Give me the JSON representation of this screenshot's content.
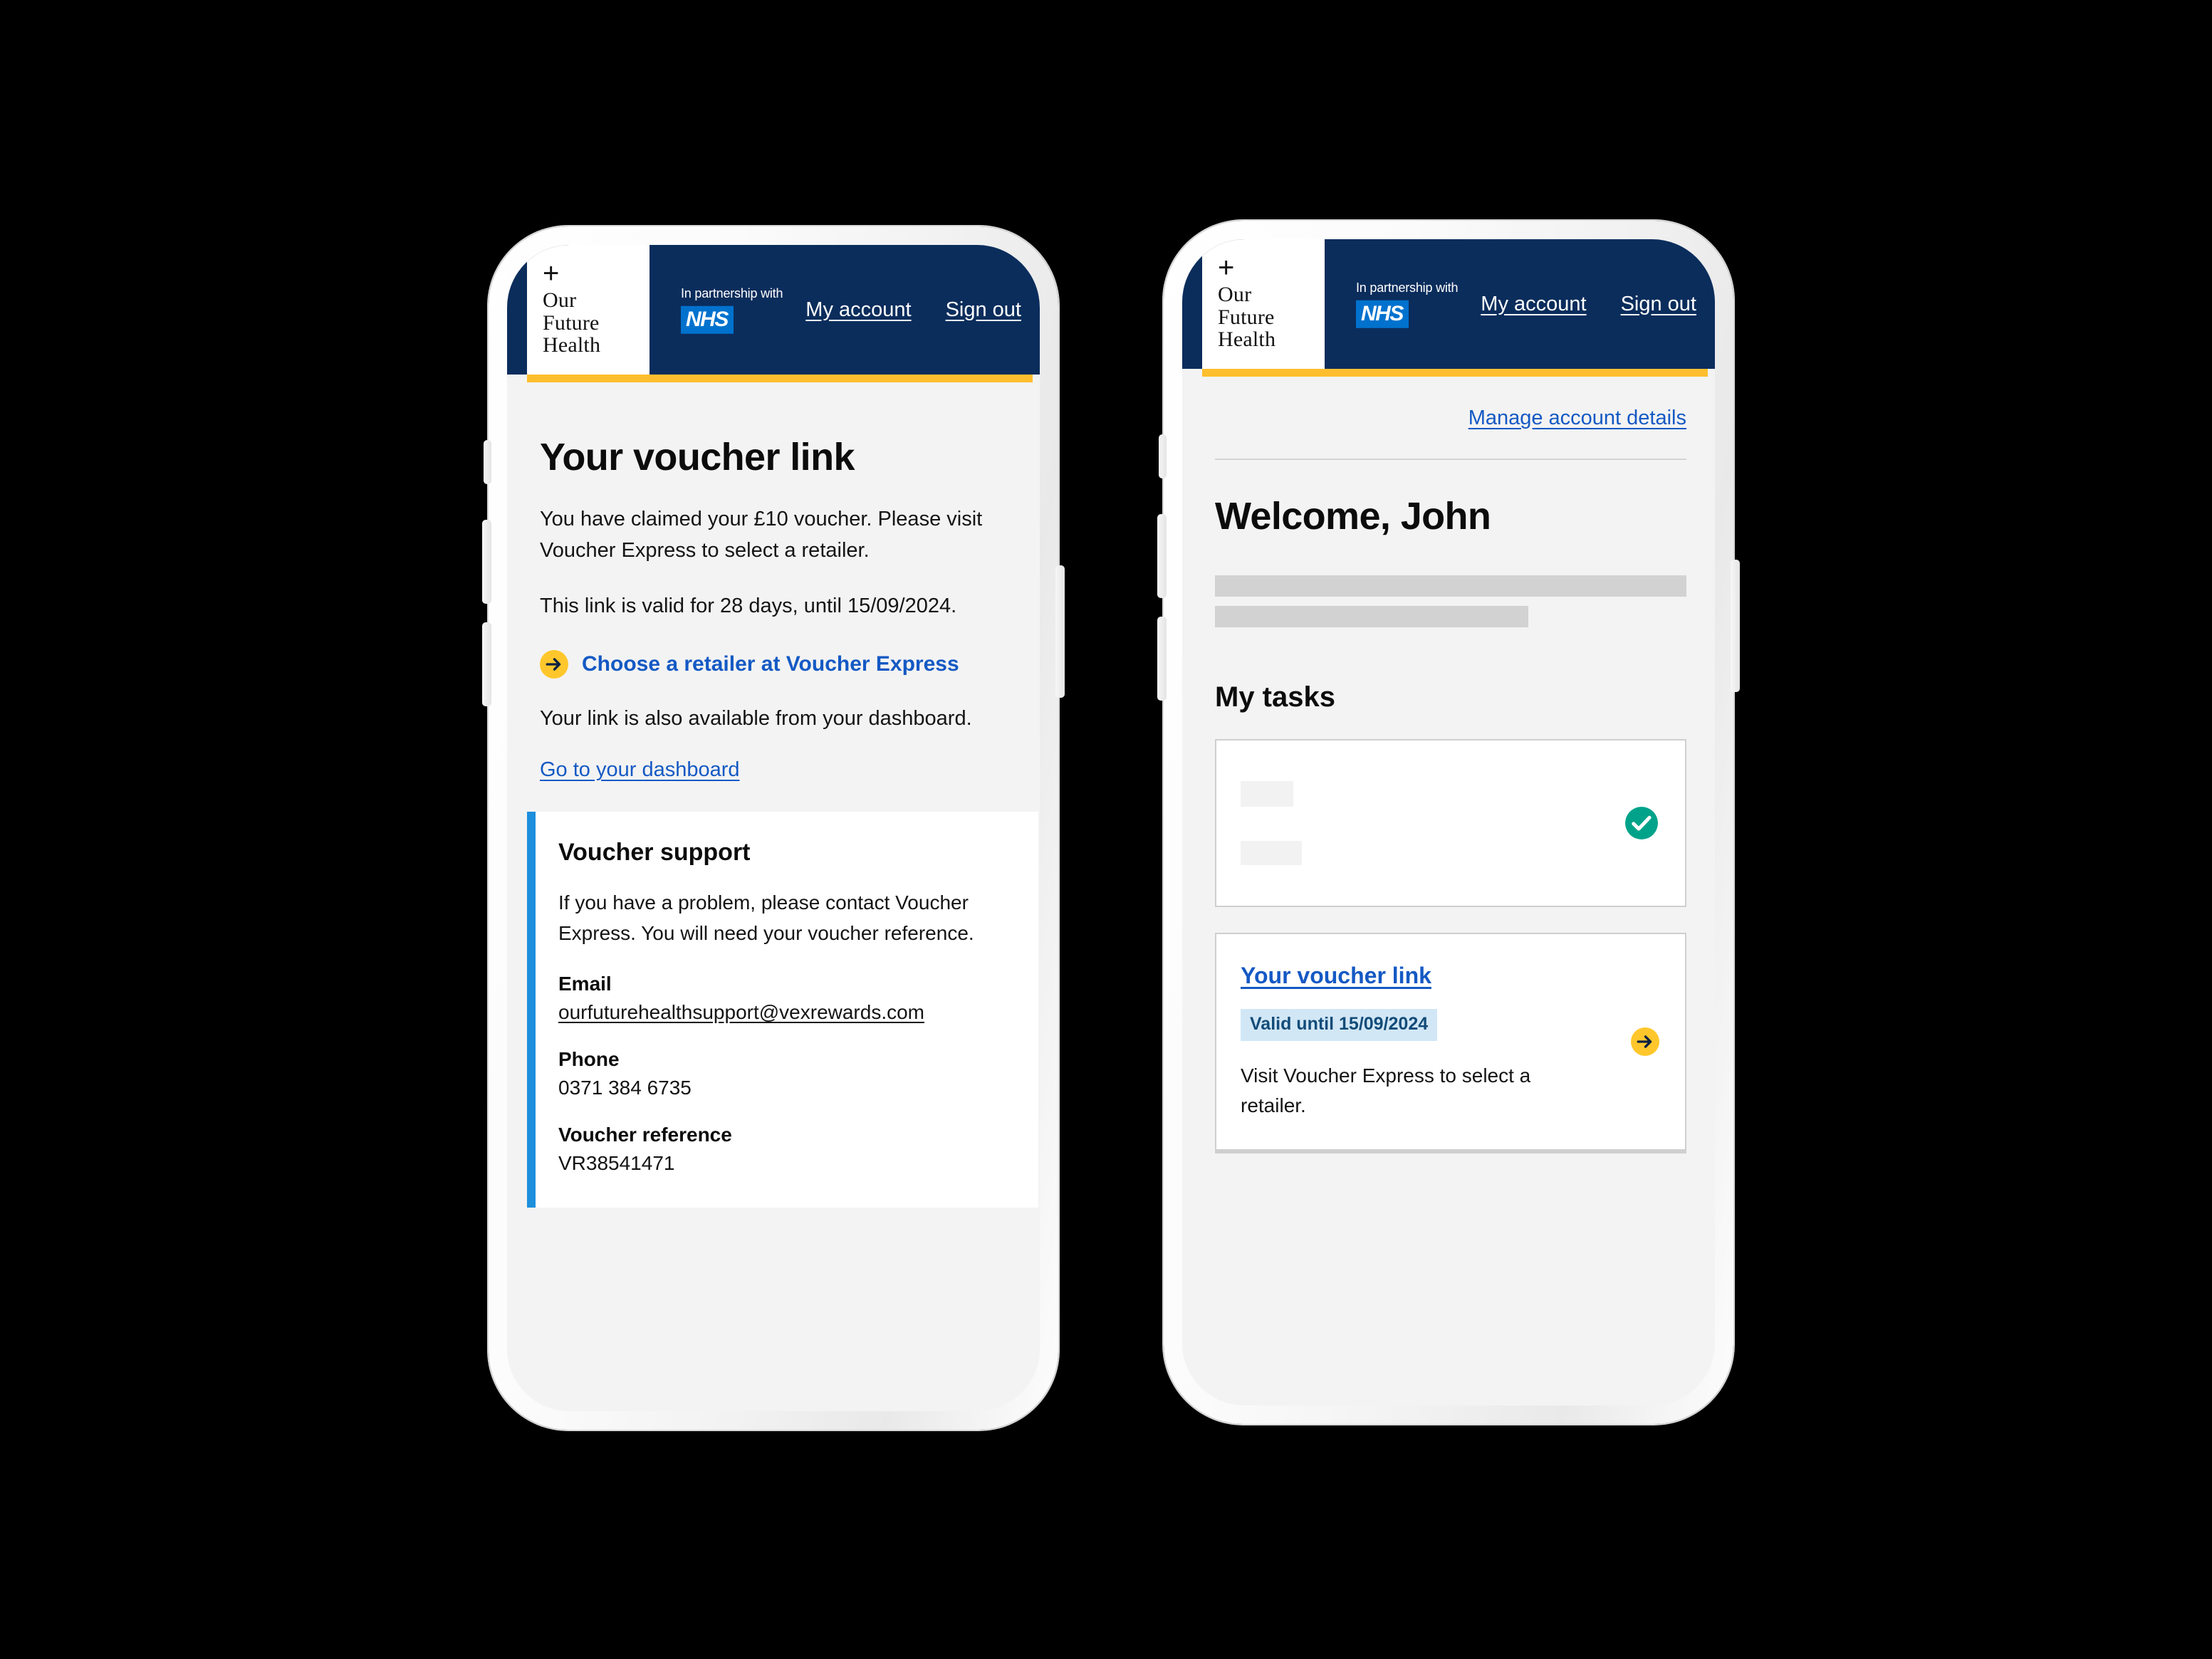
{
  "header": {
    "logo": {
      "plus": "+",
      "line1": "Our",
      "line2": "Future",
      "line3": "Health"
    },
    "partnership_caption": "In partnership with",
    "nhs_label": "NHS",
    "my_account": "My account",
    "sign_out": "Sign out"
  },
  "colors": {
    "navy": "#0b2d5c",
    "accent_yellow": "#FFBE2E",
    "arrow_yellow": "#FFC72C",
    "link_blue": "#1459C4",
    "nhs_blue": "#0072CE",
    "panel_blue": "#1D8FDC",
    "badge_bg": "#D2E7F6",
    "badge_text": "#124C79",
    "check_green": "#00A38A",
    "page_bg": "#f3f3f3"
  },
  "voucher_page": {
    "title": "Your voucher link",
    "intro": "You have claimed your £10 voucher. Please visit Voucher Express to select a retailer.",
    "validity": "This link is valid for 28 days, until 15/09/2024.",
    "cta_link": "Choose a retailer at Voucher Express",
    "dashboard_note": "Your link is also available from your dashboard.",
    "dashboard_link": "Go to your dashboard",
    "support": {
      "title": "Voucher support",
      "text": "If you have a problem, please contact Voucher Express. You will need your voucher reference.",
      "email_label": "Email",
      "email_value": "ourfuturehealthsupport@vexrewards.com",
      "phone_label": "Phone",
      "phone_value": "0371 384 6735",
      "reference_label": "Voucher reference",
      "reference_value": "VR38541471"
    }
  },
  "dashboard_page": {
    "manage_account_link": "Manage account details",
    "welcome": "Welcome, John",
    "tasks_heading": "My tasks",
    "completed_task": {
      "status": "completed"
    },
    "voucher_task": {
      "title": "Your voucher link",
      "badge": "Valid until 15/09/2024",
      "description": "Visit Voucher Express to select a retailer."
    }
  }
}
